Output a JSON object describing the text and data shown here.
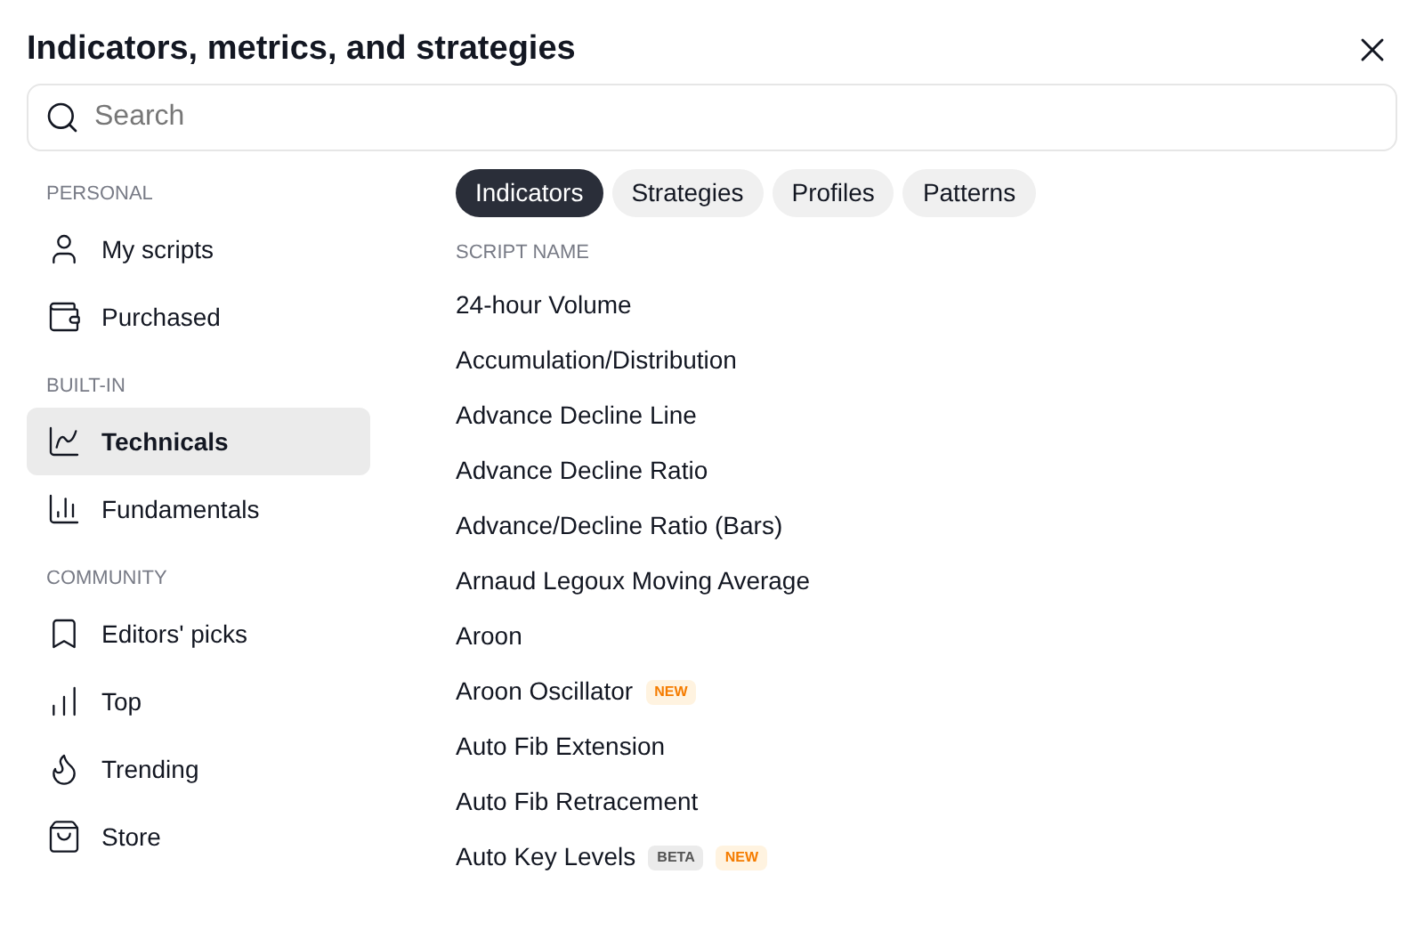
{
  "dialog": {
    "title": "Indicators, metrics, and strategies"
  },
  "search": {
    "placeholder": "Search"
  },
  "sidebar": {
    "sections": [
      {
        "label": "PERSONAL",
        "items": [
          {
            "label": "My scripts",
            "kind": "user",
            "selected": false
          },
          {
            "label": "Purchased",
            "kind": "wallet",
            "selected": false
          }
        ]
      },
      {
        "label": "BUILT-IN",
        "items": [
          {
            "label": "Technicals",
            "kind": "technicals",
            "selected": true
          },
          {
            "label": "Fundamentals",
            "kind": "fundamentals",
            "selected": false
          }
        ]
      },
      {
        "label": "COMMUNITY",
        "items": [
          {
            "label": "Editors' picks",
            "kind": "bookmark",
            "selected": false
          },
          {
            "label": "Top",
            "kind": "top",
            "selected": false
          },
          {
            "label": "Trending",
            "kind": "flame",
            "selected": false
          },
          {
            "label": "Store",
            "kind": "bag",
            "selected": false
          }
        ]
      }
    ]
  },
  "tabs": [
    {
      "label": "Indicators",
      "selected": true
    },
    {
      "label": "Strategies",
      "selected": false
    },
    {
      "label": "Profiles",
      "selected": false
    },
    {
      "label": "Patterns",
      "selected": false
    }
  ],
  "list": {
    "header": "SCRIPT NAME",
    "rows": [
      {
        "name": "24-hour Volume"
      },
      {
        "name": "Accumulation/Distribution"
      },
      {
        "name": "Advance Decline Line"
      },
      {
        "name": "Advance Decline Ratio"
      },
      {
        "name": "Advance/Decline Ratio (Bars)"
      },
      {
        "name": "Arnaud Legoux Moving Average"
      },
      {
        "name": "Aroon"
      },
      {
        "name": "Aroon Oscillator",
        "badges": [
          {
            "label": "NEW",
            "kind": "new"
          }
        ]
      },
      {
        "name": "Auto Fib Extension"
      },
      {
        "name": "Auto Fib Retracement"
      },
      {
        "name": "Auto Key Levels",
        "badges": [
          {
            "label": "BETA",
            "kind": "beta"
          },
          {
            "label": "NEW",
            "kind": "new"
          }
        ]
      }
    ]
  }
}
